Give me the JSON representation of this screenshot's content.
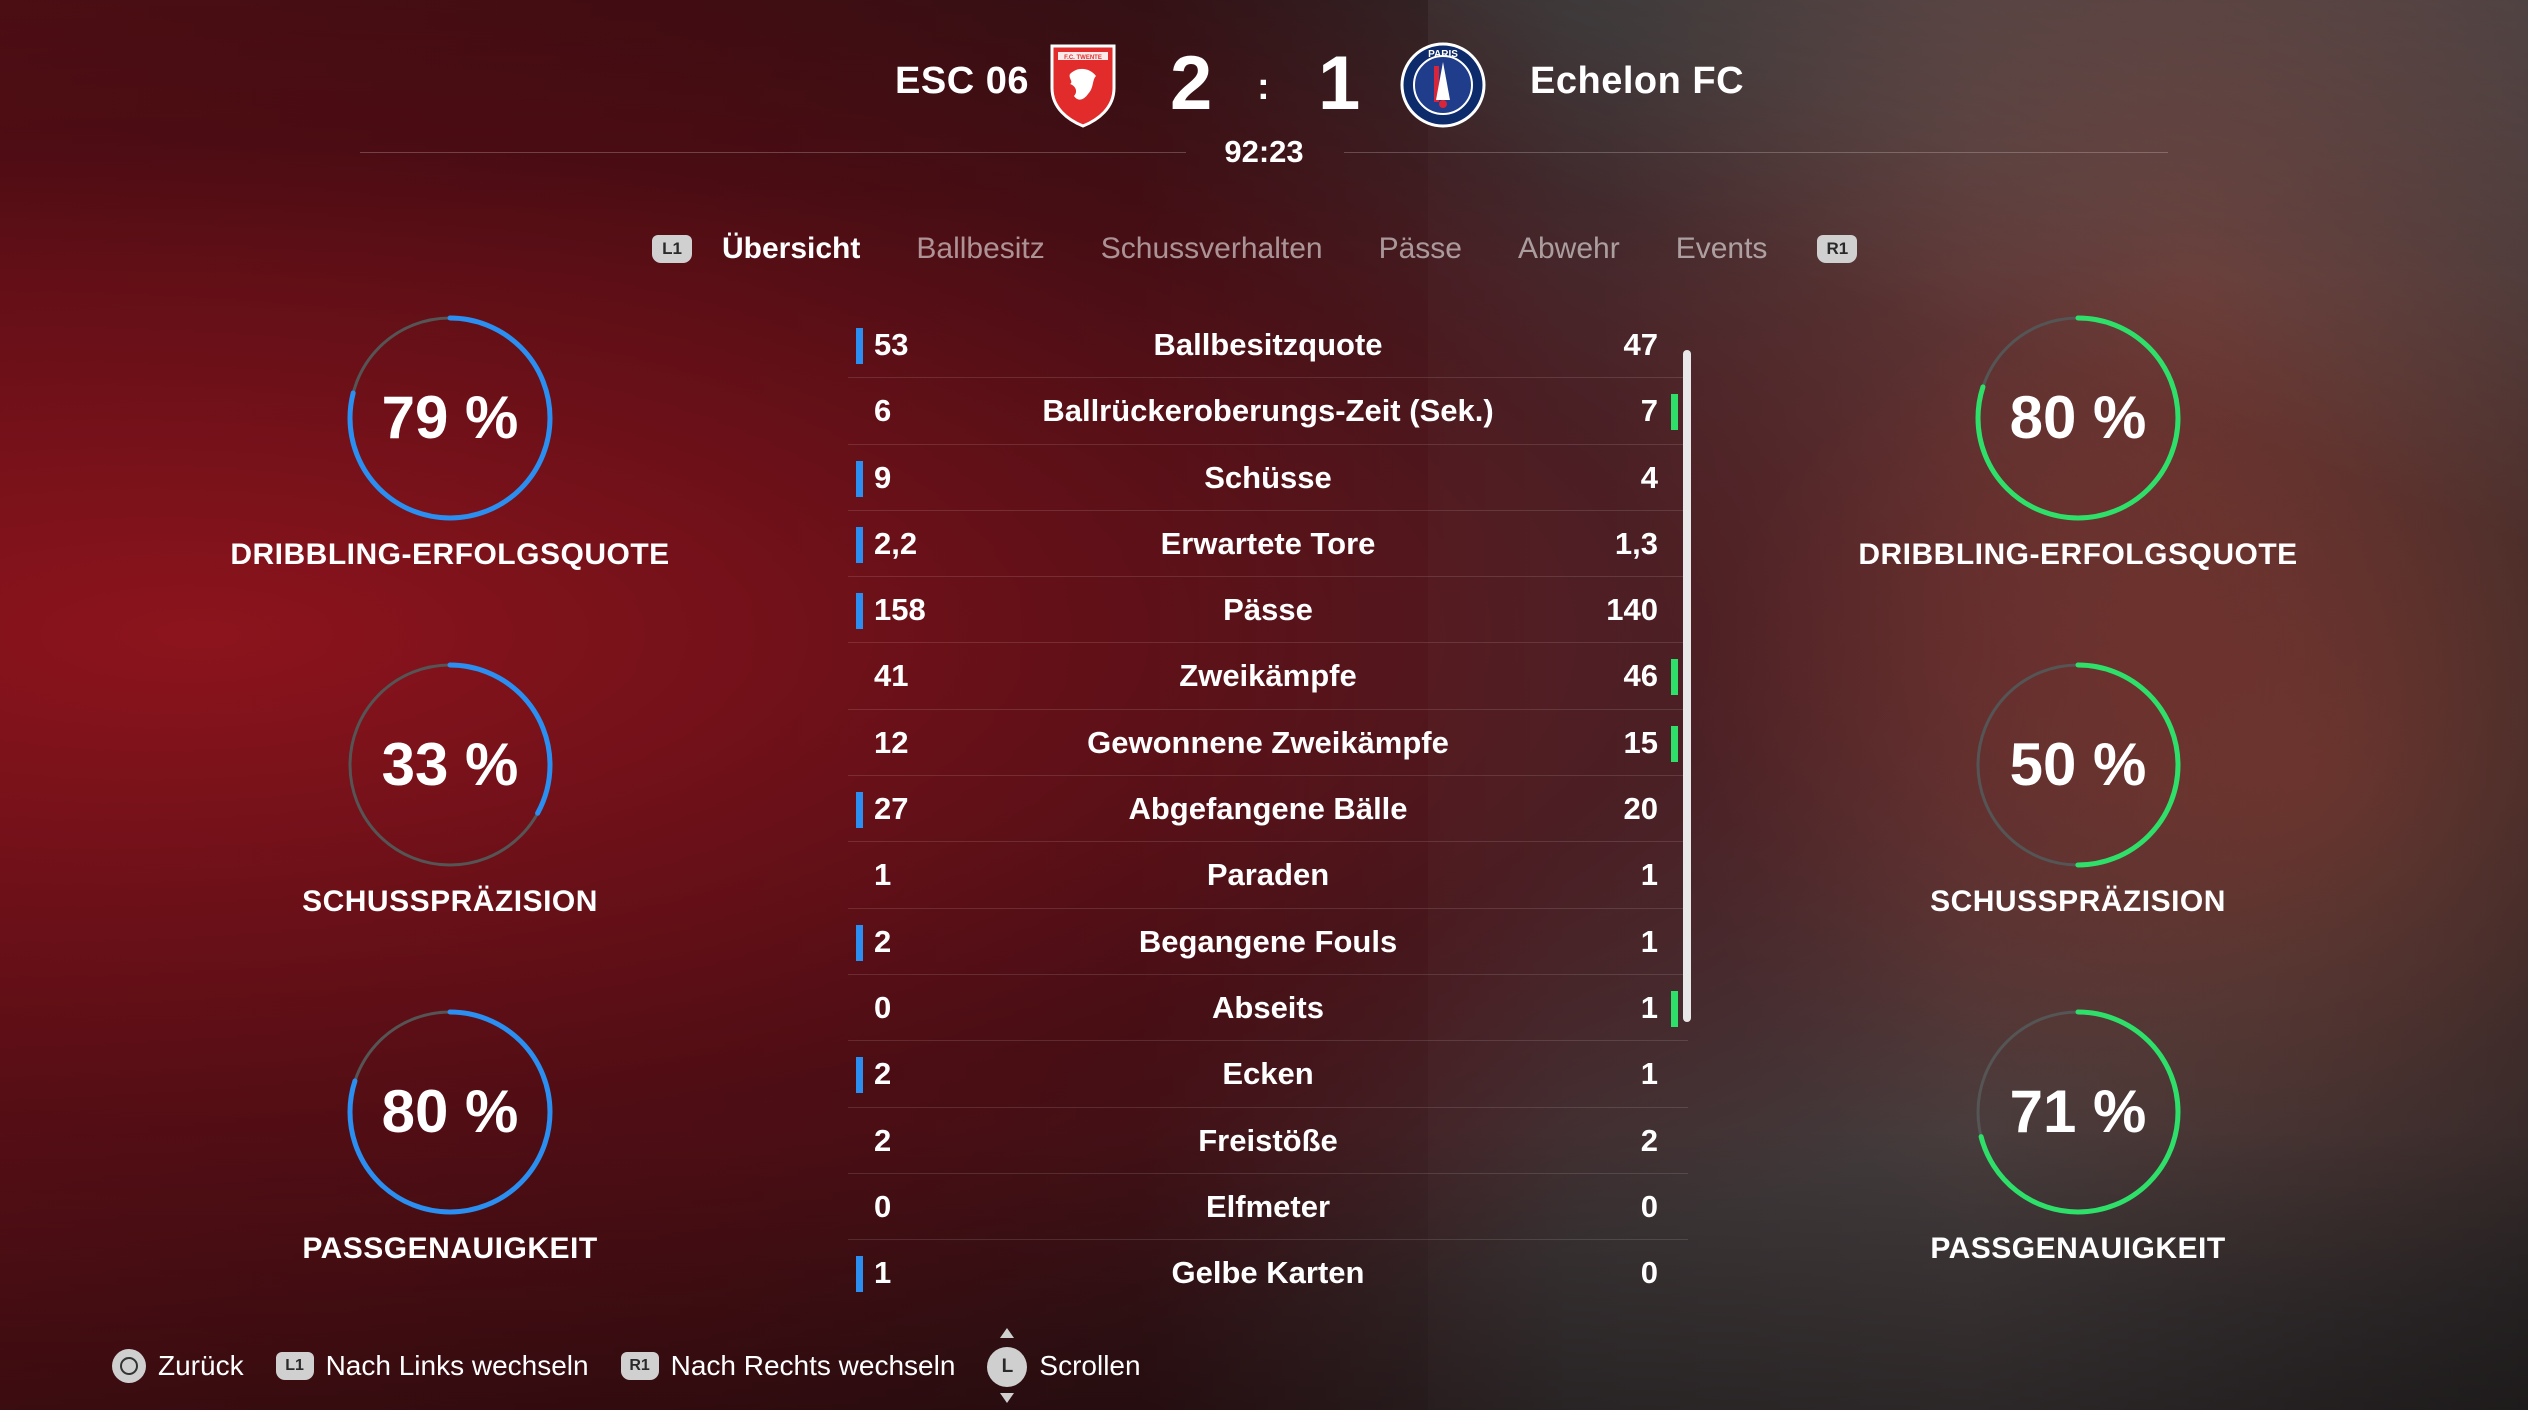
{
  "match": {
    "home_team": "ESC 06",
    "away_team": "Echelon FC",
    "home_score": "2",
    "away_score": "1",
    "separator": ":",
    "clock": "92:23",
    "home_crest_icon": "red-crest-icon",
    "away_crest_icon": "blue-round-crest-icon",
    "home_crest_text": "F.C. TWENTE",
    "away_crest_text": "PARIS"
  },
  "tabs": {
    "left_hint": "L1",
    "right_hint": "R1",
    "items": [
      "Übersicht",
      "Ballbesitz",
      "Schussverhalten",
      "Pässe",
      "Abwehr",
      "Events"
    ],
    "active": "Übersicht"
  },
  "colors": {
    "home_accent": "#2a8ff0",
    "away_accent": "#2ee06a",
    "gauge_track": "#555555"
  },
  "home_gauges": [
    {
      "value": "79 %",
      "percent": 79,
      "label": "DRIBBLING-ERFOLGSQUOTE"
    },
    {
      "value": "33 %",
      "percent": 33,
      "label": "SCHUSSPRÄZISION"
    },
    {
      "value": "80 %",
      "percent": 80,
      "label": "PASSGENAUIGKEIT"
    }
  ],
  "away_gauges": [
    {
      "value": "80 %",
      "percent": 80,
      "label": "DRIBBLING-ERFOLGSQUOTE"
    },
    {
      "value": "50 %",
      "percent": 50,
      "label": "SCHUSSPRÄZISION"
    },
    {
      "value": "71 %",
      "percent": 71,
      "label": "PASSGENAUIGKEIT"
    }
  ],
  "stats": [
    {
      "name": "Ballbesitzquote",
      "home": "53",
      "away": "47",
      "leader": "home"
    },
    {
      "name": "Ballrückeroberungs-Zeit (Sek.)",
      "home": "6",
      "away": "7",
      "leader": "away"
    },
    {
      "name": "Schüsse",
      "home": "9",
      "away": "4",
      "leader": "home"
    },
    {
      "name": "Erwartete Tore",
      "home": "2,2",
      "away": "1,3",
      "leader": "home"
    },
    {
      "name": "Pässe",
      "home": "158",
      "away": "140",
      "leader": "home"
    },
    {
      "name": "Zweikämpfe",
      "home": "41",
      "away": "46",
      "leader": "away"
    },
    {
      "name": "Gewonnene Zweikämpfe",
      "home": "12",
      "away": "15",
      "leader": "away"
    },
    {
      "name": "Abgefangene Bälle",
      "home": "27",
      "away": "20",
      "leader": "home"
    },
    {
      "name": "Paraden",
      "home": "1",
      "away": "1",
      "leader": "none"
    },
    {
      "name": "Begangene Fouls",
      "home": "2",
      "away": "1",
      "leader": "home"
    },
    {
      "name": "Abseits",
      "home": "0",
      "away": "1",
      "leader": "away"
    },
    {
      "name": "Ecken",
      "home": "2",
      "away": "1",
      "leader": "home"
    },
    {
      "name": "Freistöße",
      "home": "2",
      "away": "2",
      "leader": "none"
    },
    {
      "name": "Elfmeter",
      "home": "0",
      "away": "0",
      "leader": "none"
    },
    {
      "name": "Gelbe Karten",
      "home": "1",
      "away": "0",
      "leader": "home"
    }
  ],
  "footer": {
    "back": "Zurück",
    "left_hint": "L1",
    "left": "Nach Links wechseln",
    "right_hint": "R1",
    "right": "Nach Rechts wechseln",
    "stick_hint": "L",
    "scroll": "Scrollen"
  }
}
